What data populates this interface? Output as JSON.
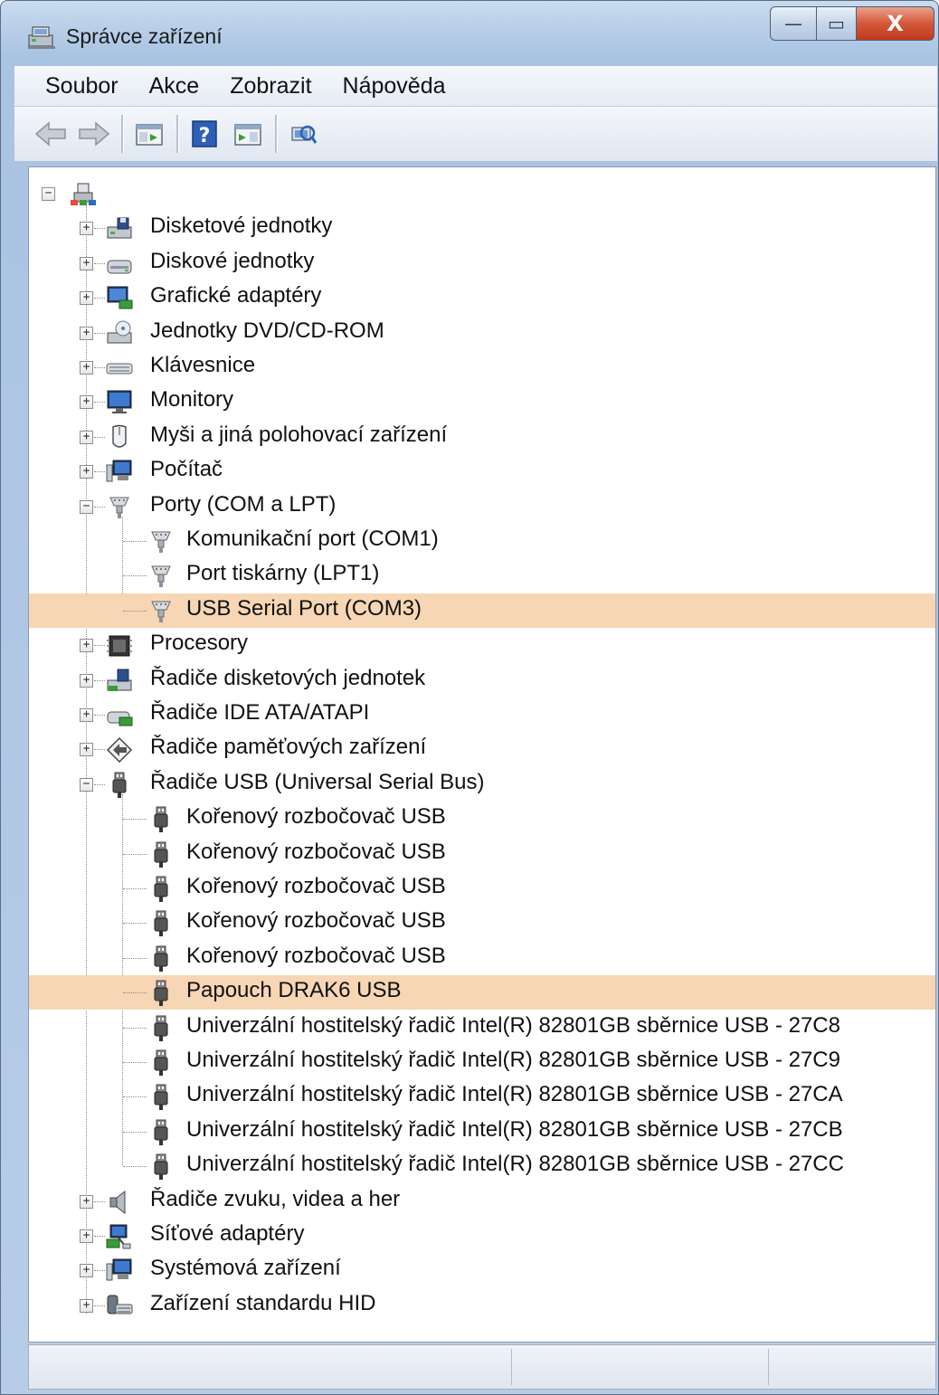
{
  "window": {
    "title": "Správce zařízení",
    "icon": "device-manager-icon",
    "caption_buttons": {
      "minimize": "—",
      "maximize": "▭",
      "close": "X"
    }
  },
  "menu": [
    {
      "label": "Soubor"
    },
    {
      "label": "Akce"
    },
    {
      "label": "Zobrazit"
    },
    {
      "label": "Nápověda"
    }
  ],
  "toolbar": [
    {
      "icon": "back-arrow-icon"
    },
    {
      "icon": "forward-arrow-icon"
    },
    {
      "icon": "show-hide-console-tree-icon"
    },
    {
      "icon": "help-icon"
    },
    {
      "icon": "show-hide-action-pane-icon"
    },
    {
      "icon": "scan-hardware-changes-icon"
    }
  ],
  "tree": {
    "root": {
      "icon": "computer-network-icon",
      "expanded": true
    },
    "items": [
      {
        "label": "Disketové jednotky",
        "icon": "floppy-drive-icon",
        "level": 1,
        "expander": "+"
      },
      {
        "label": "Diskové jednotky",
        "icon": "disk-drive-icon",
        "level": 1,
        "expander": "+"
      },
      {
        "label": "Grafické adaptéry",
        "icon": "display-adapter-icon",
        "level": 1,
        "expander": "+"
      },
      {
        "label": "Jednotky DVD/CD-ROM",
        "icon": "dvd-drive-icon",
        "level": 1,
        "expander": "+"
      },
      {
        "label": "Klávesnice",
        "icon": "keyboard-icon",
        "level": 1,
        "expander": "+"
      },
      {
        "label": "Monitory",
        "icon": "monitor-icon",
        "level": 1,
        "expander": "+"
      },
      {
        "label": "Myši a jiná polohovací zařízení",
        "icon": "mouse-icon",
        "level": 1,
        "expander": "+"
      },
      {
        "label": "Počítač",
        "icon": "computer-icon",
        "level": 1,
        "expander": "+"
      },
      {
        "label": "Porty (COM a LPT)",
        "icon": "port-icon",
        "level": 1,
        "expander": "−"
      },
      {
        "label": "Komunikační port (COM1)",
        "icon": "port-icon",
        "level": 2
      },
      {
        "label": "Port tiskárny (LPT1)",
        "icon": "port-icon",
        "level": 2
      },
      {
        "label": "USB Serial Port (COM3)",
        "icon": "port-icon",
        "level": 2,
        "selected": true
      },
      {
        "label": "Procesory",
        "icon": "processor-icon",
        "level": 1,
        "expander": "+"
      },
      {
        "label": "Řadiče disketových jednotek",
        "icon": "floppy-controller-icon",
        "level": 1,
        "expander": "+"
      },
      {
        "label": "Řadiče IDE ATA/ATAPI",
        "icon": "ide-controller-icon",
        "level": 1,
        "expander": "+"
      },
      {
        "label": "Řadiče paměťových zařízení",
        "icon": "storage-controller-icon",
        "level": 1,
        "expander": "+"
      },
      {
        "label": "Řadiče USB (Universal Serial Bus)",
        "icon": "usb-icon",
        "level": 1,
        "expander": "−"
      },
      {
        "label": "Kořenový rozbočovač USB",
        "icon": "usb-icon",
        "level": 2
      },
      {
        "label": "Kořenový rozbočovač USB",
        "icon": "usb-icon",
        "level": 2
      },
      {
        "label": "Kořenový rozbočovač USB",
        "icon": "usb-icon",
        "level": 2
      },
      {
        "label": "Kořenový rozbočovač USB",
        "icon": "usb-icon",
        "level": 2
      },
      {
        "label": "Kořenový rozbočovač USB",
        "icon": "usb-icon",
        "level": 2
      },
      {
        "label": "Papouch DRAK6 USB",
        "icon": "usb-icon",
        "level": 2,
        "selected": true
      },
      {
        "label": "Univerzální hostitelský řadič Intel(R) 82801GB sběrnice USB - 27C8",
        "icon": "usb-icon",
        "level": 2
      },
      {
        "label": "Univerzální hostitelský řadič Intel(R) 82801GB sběrnice USB - 27C9",
        "icon": "usb-icon",
        "level": 2
      },
      {
        "label": "Univerzální hostitelský řadič Intel(R) 82801GB sběrnice USB - 27CA",
        "icon": "usb-icon",
        "level": 2
      },
      {
        "label": "Univerzální hostitelský řadič Intel(R) 82801GB sběrnice USB - 27CB",
        "icon": "usb-icon",
        "level": 2
      },
      {
        "label": "Univerzální hostitelský řadič Intel(R) 82801GB sběrnice USB - 27CC",
        "icon": "usb-icon",
        "level": 2
      },
      {
        "label": "Řadiče zvuku, videa a her",
        "icon": "speaker-icon",
        "level": 1,
        "expander": "+"
      },
      {
        "label": "Síťové adaptéry",
        "icon": "network-adapter-icon",
        "level": 1,
        "expander": "+"
      },
      {
        "label": "Systémová zařízení",
        "icon": "system-device-icon",
        "level": 1,
        "expander": "+"
      },
      {
        "label": "Zařízení standardu HID",
        "icon": "hid-device-icon",
        "level": 1,
        "expander": "+"
      }
    ]
  },
  "colors": {
    "selection": "#f6d6b4",
    "accent": "#2a5ba8"
  }
}
